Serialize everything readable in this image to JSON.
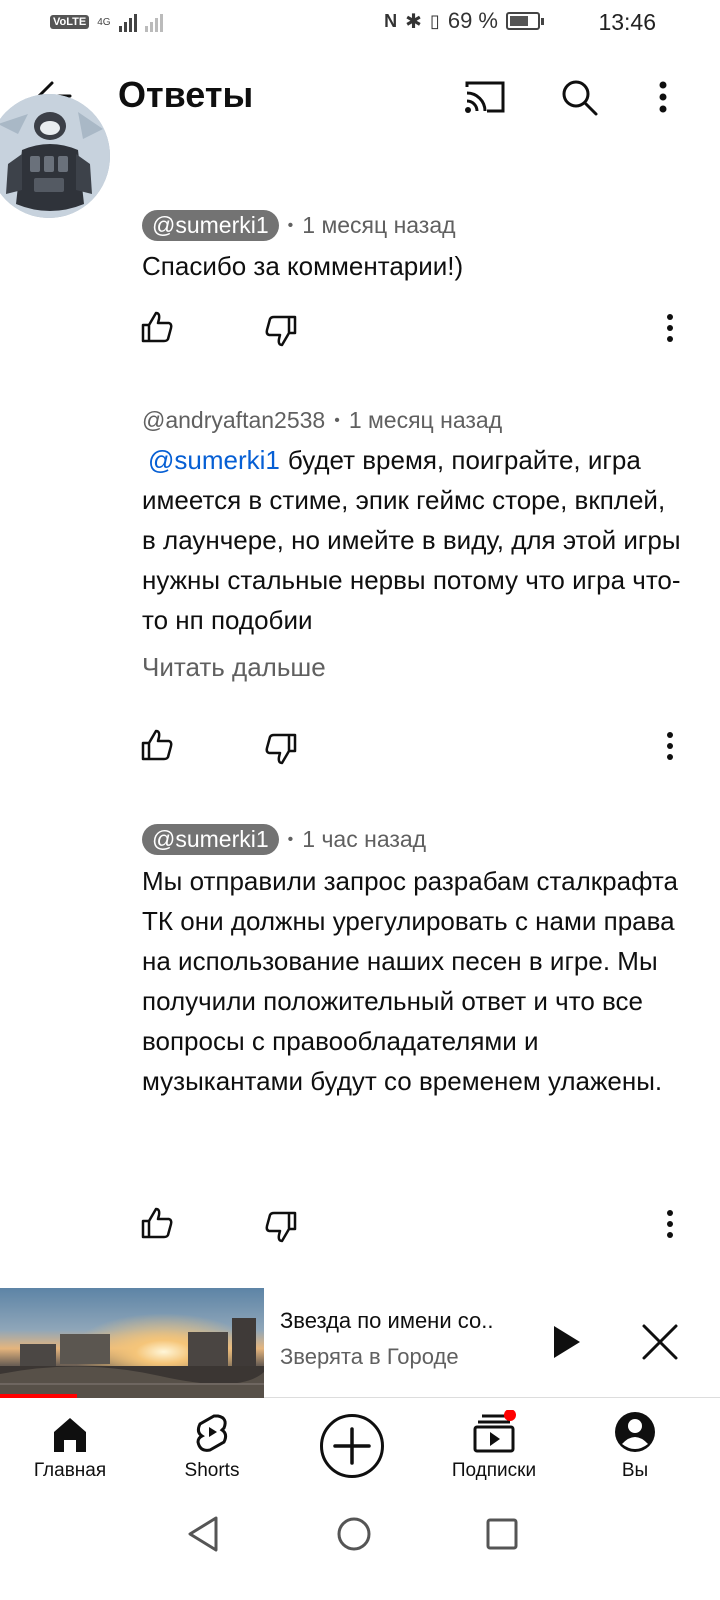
{
  "status_bar": {
    "volte": "VoLTE",
    "network": "4G",
    "battery": "69 %",
    "battery_level": 0.69,
    "time": "13:46"
  },
  "header": {
    "title": "Ответы",
    "icons": [
      "back-arrow-icon",
      "cast-icon",
      "search-icon",
      "more-vert-icon"
    ]
  },
  "comments": [
    {
      "author": "@sumerki1",
      "author_style": "highlighted",
      "time": "1 месяц назад",
      "text": "Спасибо за комментарии!)"
    },
    {
      "author": "@andryaftan2538",
      "author_style": "plain",
      "time": "1 месяц назад",
      "mention": "@sumerki1",
      "text": "будет время, поиграйте, игра имеется в стиме, эпик геймс сторе, вкплей, в лаунчере, но имейте в виду, для этой игры нужны стальные нервы потому что игра что-то нп подобии",
      "read_more": "Читать дальше"
    },
    {
      "author": "@sumerki1",
      "author_style": "highlighted",
      "time": "1 час назад",
      "text": "Мы отправили запрос разрабам сталкрафта ТК они должны урегулировать с нами права на использование наших песен в игре. Мы получили положительный ответ и что все вопросы с правообладателями и музыкантами будут со временем улажены."
    }
  ],
  "mini_player": {
    "title": "Звезда по имени со..",
    "channel": "Зверята в Городе",
    "progress": 0.29
  },
  "bottom_nav": {
    "home": "Главная",
    "shorts": "Shorts",
    "subscriptions": "Подписки",
    "you": "Вы"
  },
  "colors": {
    "mention": "#065fd4",
    "pill": "#737373",
    "progress": "#ff0000",
    "notification_dot": "#ff0000"
  }
}
